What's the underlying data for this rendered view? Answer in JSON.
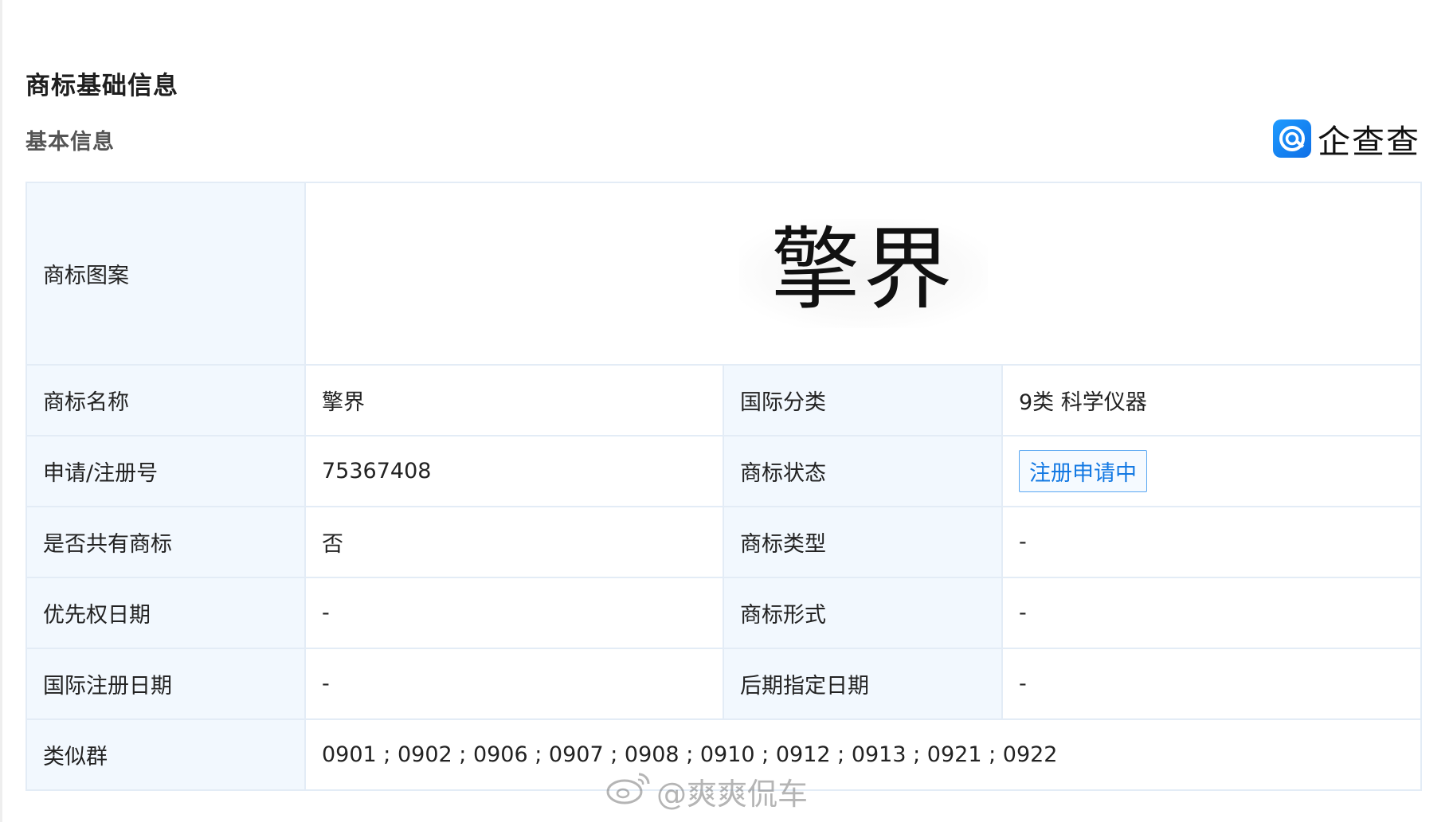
{
  "header": {
    "section_title": "商标基础信息",
    "sub_title": "基本信息",
    "brand_name": "企查查",
    "brand_color": "#1a8cff"
  },
  "table": {
    "pattern": {
      "label": "商标图案",
      "text": "擎界"
    },
    "rows": [
      {
        "label1": "商标名称",
        "value1": "擎界",
        "label2": "国际分类",
        "value2": "9类 科学仪器"
      },
      {
        "label1": "申请/注册号",
        "value1": "75367408",
        "label2": "商标状态",
        "value2": "注册申请中"
      },
      {
        "label1": "是否共有商标",
        "value1": "否",
        "label2": "商标类型",
        "value2": "-"
      },
      {
        "label1": "优先权日期",
        "value1": "-",
        "label2": "商标形式",
        "value2": "-"
      },
      {
        "label1": "国际注册日期",
        "value1": "-",
        "label2": "后期指定日期",
        "value2": "-"
      }
    ],
    "similar_group": {
      "label": "类似群",
      "value": "0901 ; 0902 ; 0906 ; 0907 ; 0908 ; 0910 ; 0912 ; 0913 ; 0921 ; 0922"
    }
  },
  "watermark": {
    "text": "@爽爽侃车",
    "icon": "weibo-icon"
  }
}
